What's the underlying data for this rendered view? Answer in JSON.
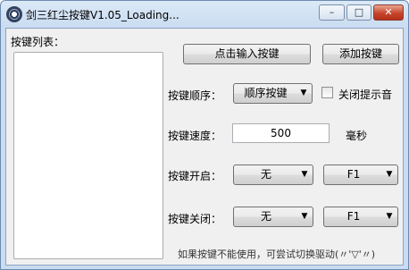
{
  "window": {
    "title": "剑三红尘按键V1.05_Loading...",
    "minimize": "–",
    "maximize": "□",
    "close": "✕"
  },
  "list": {
    "label": "按键列表："
  },
  "buttons": {
    "input_key": "点击输入按键",
    "add_key": "添加按键"
  },
  "order": {
    "label": "按键顺序：",
    "value": "顺序按键",
    "mute_label": "关闭提示音",
    "mute_checked": false
  },
  "speed": {
    "label": "按键速度：",
    "value": "500",
    "unit": "毫秒"
  },
  "start": {
    "label": "按键开启：",
    "modifier": "无",
    "key": "F1"
  },
  "stop": {
    "label": "按键关闭：",
    "modifier": "无",
    "key": "F1"
  },
  "hint": "如果按键不能使用，可尝试切换驱动(〃'▽'〃)",
  "icons": {
    "dropdown": "▼"
  }
}
